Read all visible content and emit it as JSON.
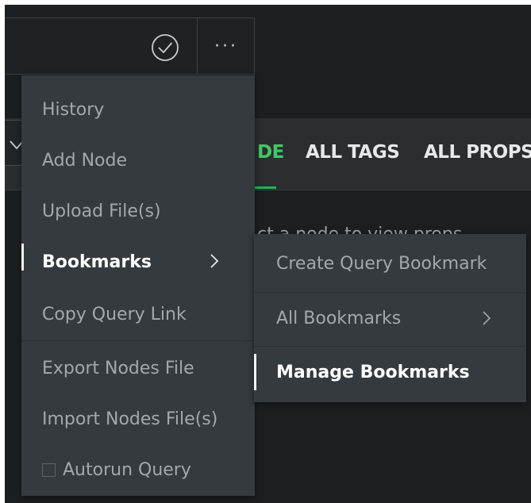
{
  "query_bar": {
    "check_icon": "check-circle-icon",
    "more_label": "···"
  },
  "tabs": [
    {
      "label": "DE",
      "active": true
    },
    {
      "label": "ALL TAGS",
      "active": false
    },
    {
      "label": "ALL PROPS",
      "active": false
    }
  ],
  "hint": "ct a node to view props",
  "menu": {
    "items": [
      {
        "label": "History"
      },
      {
        "label": "Add Node"
      },
      {
        "label": "Upload File(s)"
      },
      {
        "label": "Bookmarks",
        "active": true,
        "has_submenu": true
      },
      {
        "label": "Copy Query Link"
      },
      {
        "label": "Export Nodes File"
      },
      {
        "label": "Import Nodes File(s)"
      },
      {
        "label": "Autorun Query",
        "checkbox": true,
        "checked": false
      }
    ]
  },
  "submenu": {
    "items": [
      {
        "label": "Create Query Bookmark"
      },
      {
        "label": "All Bookmarks",
        "has_submenu": true
      },
      {
        "label": "Manage Bookmarks",
        "active": true
      }
    ]
  },
  "colors": {
    "background": "#1c1f21",
    "menu_bg": "#353a3e",
    "accent_green": "#44c765",
    "text_muted": "#a3a8ad",
    "text_active": "#ffffff"
  }
}
